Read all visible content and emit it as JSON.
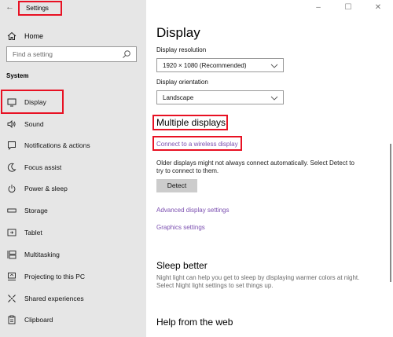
{
  "window": {
    "title": "Settings",
    "controls": [
      "–",
      "☐",
      "✕"
    ]
  },
  "sidebar": {
    "home_label": "Home",
    "search_placeholder": "Find a setting",
    "section_label": "System",
    "items": [
      {
        "label": "Display",
        "icon": "monitor-icon"
      },
      {
        "label": "Sound",
        "icon": "speaker-icon"
      },
      {
        "label": "Notifications & actions",
        "icon": "notifications-icon"
      },
      {
        "label": "Focus assist",
        "icon": "moon-icon"
      },
      {
        "label": "Power & sleep",
        "icon": "power-icon"
      },
      {
        "label": "Storage",
        "icon": "storage-icon"
      },
      {
        "label": "Tablet",
        "icon": "tablet-icon"
      },
      {
        "label": "Multitasking",
        "icon": "multitasking-icon"
      },
      {
        "label": "Projecting to this PC",
        "icon": "projecting-icon"
      },
      {
        "label": "Shared experiences",
        "icon": "shared-experiences-icon"
      },
      {
        "label": "Clipboard",
        "icon": "clipboard-icon"
      }
    ]
  },
  "main": {
    "title": "Display",
    "resolution_label": "Display resolution",
    "resolution_value": "1920 × 1080 (Recommended)",
    "orientation_label": "Display orientation",
    "orientation_value": "Landscape",
    "multiple_displays_heading": "Multiple displays",
    "connect_link": "Connect to a wireless display",
    "detect_text_line1": "Older displays might not always connect automatically. Select Detect to",
    "detect_text_line2": "try to connect to them.",
    "detect_button": "Detect",
    "advanced_link": "Advanced display settings",
    "graphics_link": "Graphics settings",
    "sleep_heading": "Sleep better",
    "sleep_text_line1": "Night light can help you get to sleep by displaying warmer colors at night.",
    "sleep_text_line2": "Select Night light settings to set things up.",
    "help_heading": "Help from the web"
  },
  "colors": {
    "highlight_frame": "#e81123",
    "link": "#7b4fb0",
    "sidebar_bg": "#e6e6e6"
  }
}
